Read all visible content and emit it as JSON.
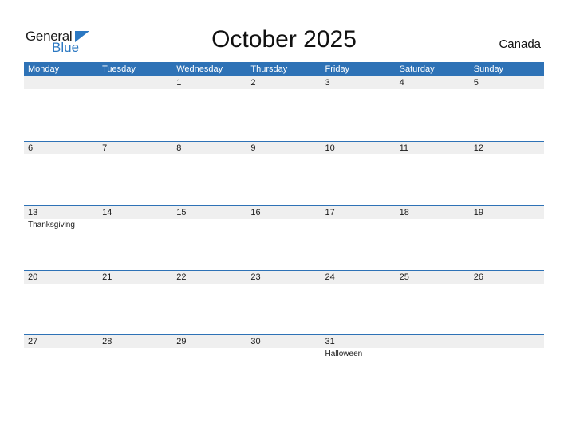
{
  "brand": {
    "word1": "General",
    "word2": "Blue",
    "color": "#2b78c2"
  },
  "title": "October 2025",
  "country": "Canada",
  "header_color": "#2e72b6",
  "weekdays": [
    "Monday",
    "Tuesday",
    "Wednesday",
    "Thursday",
    "Friday",
    "Saturday",
    "Sunday"
  ],
  "weeks": [
    {
      "days": [
        "",
        "",
        "1",
        "2",
        "3",
        "4",
        "5"
      ],
      "events": [
        "",
        "",
        "",
        "",
        "",
        "",
        ""
      ]
    },
    {
      "days": [
        "6",
        "7",
        "8",
        "9",
        "10",
        "11",
        "12"
      ],
      "events": [
        "",
        "",
        "",
        "",
        "",
        "",
        ""
      ]
    },
    {
      "days": [
        "13",
        "14",
        "15",
        "16",
        "17",
        "18",
        "19"
      ],
      "events": [
        "Thanksgiving",
        "",
        "",
        "",
        "",
        "",
        ""
      ]
    },
    {
      "days": [
        "20",
        "21",
        "22",
        "23",
        "24",
        "25",
        "26"
      ],
      "events": [
        "",
        "",
        "",
        "",
        "",
        "",
        ""
      ]
    },
    {
      "days": [
        "27",
        "28",
        "29",
        "30",
        "31",
        "",
        ""
      ],
      "events": [
        "",
        "",
        "",
        "",
        "Halloween",
        "",
        ""
      ]
    }
  ]
}
